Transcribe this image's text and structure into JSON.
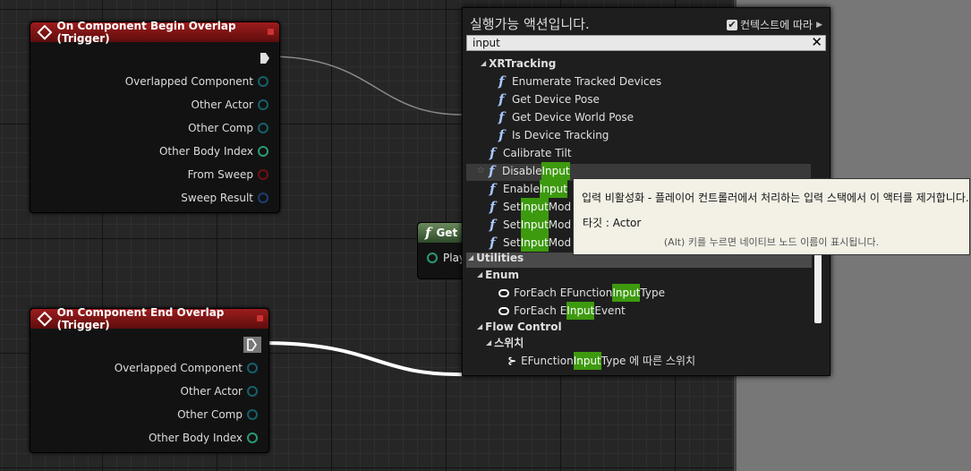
{
  "node_begin": {
    "title": "On Component Begin Overlap (Trigger)",
    "pins": [
      "Overlapped Component",
      "Other Actor",
      "Other Comp",
      "Other Body Index",
      "From Sweep",
      "Sweep Result"
    ]
  },
  "node_end": {
    "title": "On Component End Overlap (Trigger)",
    "pins": [
      "Overlapped Component",
      "Other Actor",
      "Other Comp",
      "Other Body Index"
    ]
  },
  "get_node": {
    "title": "Get",
    "pin": "Play"
  },
  "menu": {
    "title": "실행가능 액션입니다.",
    "context_label": "컨텍스트에 따라",
    "context_checked": true,
    "search_value": "input",
    "items": [
      {
        "kind": "cat",
        "label": "XRTracking"
      },
      {
        "kind": "fn",
        "label": "Enumerate Tracked Devices"
      },
      {
        "kind": "fn",
        "label": "Get Device Pose"
      },
      {
        "kind": "fn",
        "label": "Get Device World Pose"
      },
      {
        "kind": "fn",
        "label": "Is Device Tracking"
      },
      {
        "kind": "fn",
        "label": "Calibrate Tilt"
      },
      {
        "kind": "fn",
        "pre": "Disable ",
        "hl": "Input",
        "post": ""
      },
      {
        "kind": "fn",
        "pre": "Enable ",
        "hl": "Input",
        "post": ""
      },
      {
        "kind": "fn",
        "pre": "Set ",
        "hl": "Input",
        "post": " Mod"
      },
      {
        "kind": "fn",
        "pre": "Set ",
        "hl": "Input",
        "post": " Mod"
      },
      {
        "kind": "fn",
        "pre": "Set ",
        "hl": "Input",
        "post": " Mod"
      },
      {
        "kind": "cat",
        "label": "Utilities"
      },
      {
        "kind": "cat",
        "label": "Enum"
      },
      {
        "kind": "loop",
        "pre": "ForEach EFunction",
        "hl": "Input",
        "post": "Type"
      },
      {
        "kind": "loop",
        "pre": "ForEach E",
        "hl": "Input",
        "post": "Event"
      },
      {
        "kind": "cat",
        "label": "Flow Control"
      },
      {
        "kind": "cat",
        "label": "스위치"
      },
      {
        "kind": "switch",
        "pre": "EFunction",
        "hl": "Input",
        "post": "Type 에 따른 스위치"
      }
    ]
  },
  "tooltip": {
    "description": "입력 비활성화 - 플레이어 컨트롤러에서 처리하는 입력 스택에서 이 액터를 제거합니다.",
    "target": "타깃 : Actor",
    "hint": "(Alt) 키를 누르면 네이티브 노드 이름이 표시됩니다."
  },
  "icons": {
    "function": "function-icon",
    "loop": "foreach-loop-icon",
    "switch": "switch-icon",
    "favorite": "star-icon"
  },
  "colors": {
    "event_header": "#8a1a1a",
    "highlight": "#3d9a0f",
    "function_header": "#4f6e45"
  }
}
